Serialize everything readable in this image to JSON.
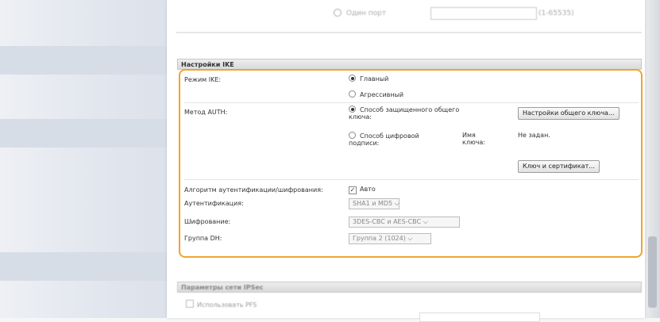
{
  "top_row": {
    "radio_label": "Один порт",
    "port_hint": "(1-65535)"
  },
  "ike_section": {
    "header": "Настройки IKE",
    "ike_mode": {
      "label": "Режим IKE:",
      "options": [
        "Главный",
        "Агрессивный"
      ],
      "selected": "Главный"
    },
    "auth_method": {
      "label": "Метод AUTH:",
      "option_psk": "Способ защищенного общего ключа:",
      "psk_button": "Настройки общего ключа...",
      "option_cert": "Способ цифровой подписи:",
      "key_name_label": "Имя ключа:",
      "key_name_value": "Не задан.",
      "cert_button": "Ключ и сертификат..."
    },
    "algorithm": {
      "label": "Алгоритм аутентификации/шифрования:",
      "auto_label": "Авто",
      "auto_checked": true
    },
    "authentication": {
      "label": "Аутентификация:",
      "value": "SHA1 и MD5"
    },
    "encryption": {
      "label": "Шифрование:",
      "value": "3DES-CBC и AES-CBC"
    },
    "dh_group": {
      "label": "Группа DH:",
      "value": "Группа 2 (1024)"
    }
  },
  "ipsec_section": {
    "header": "Параметры сети IPSec",
    "pfs_label": "Использовать PFS"
  },
  "icons": {
    "dropdown": "chevron-down-icon",
    "checkmark": "checkmark-icon"
  },
  "colors": {
    "highlight_border": "#f0a42e"
  }
}
